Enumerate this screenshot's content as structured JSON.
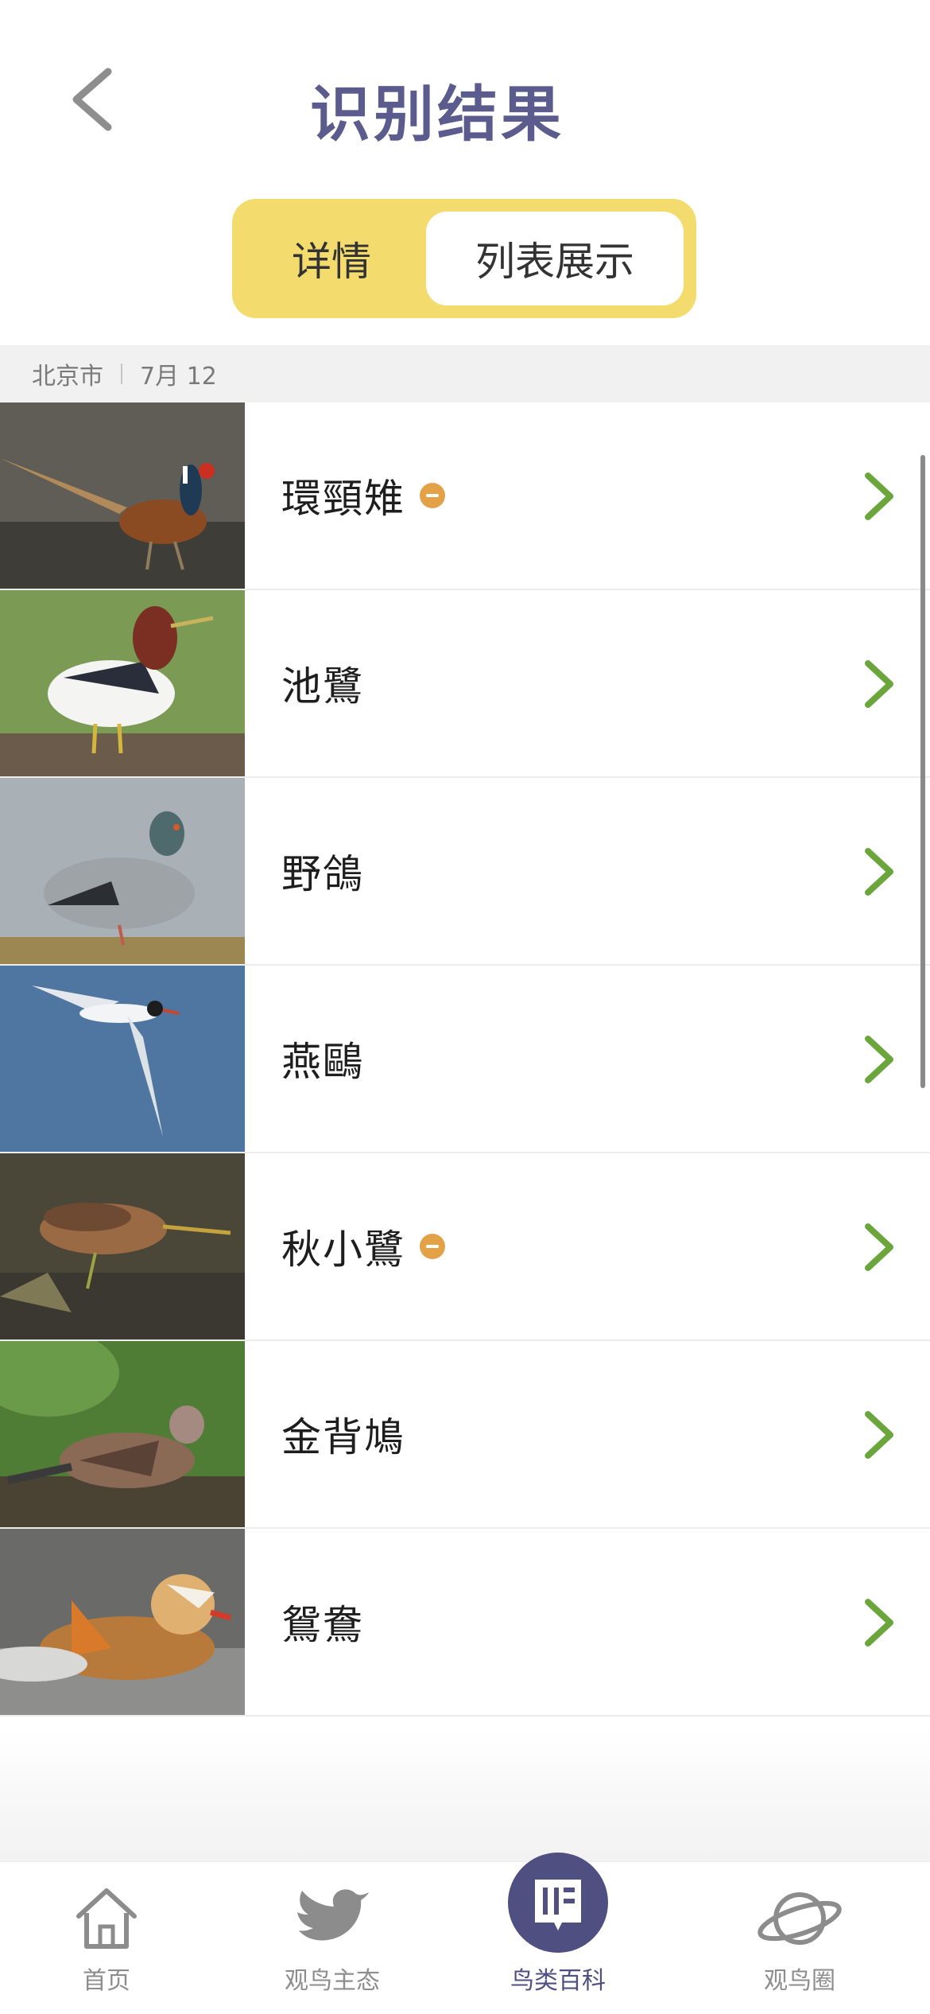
{
  "header": {
    "title": "识别结果"
  },
  "segment": {
    "detail_label": "详情",
    "list_label": "列表展示"
  },
  "location": {
    "city": "北京市",
    "date": "7月 12"
  },
  "birds": [
    {
      "name": "環頸雉",
      "badge": true
    },
    {
      "name": "池鷺",
      "badge": false
    },
    {
      "name": "野鴿",
      "badge": false
    },
    {
      "name": "燕鷗",
      "badge": false
    },
    {
      "name": "秋小鷺",
      "badge": true
    },
    {
      "name": "金背鳩",
      "badge": false
    },
    {
      "name": "鴛鴦",
      "badge": false
    }
  ],
  "tabbar": [
    {
      "label": "首页",
      "icon": "home-icon"
    },
    {
      "label": "观鸟主态",
      "icon": "bird-icon"
    },
    {
      "label": "鸟类百科",
      "icon": "book-icon",
      "active": true
    },
    {
      "label": "观鸟圈",
      "icon": "planet-icon"
    }
  ],
  "colors": {
    "accent": "#f3dc6d",
    "title": "#5b5b8d",
    "chevron": "#6aa63b",
    "badge": "#e3a247",
    "tab_active": "#4f4f82"
  }
}
